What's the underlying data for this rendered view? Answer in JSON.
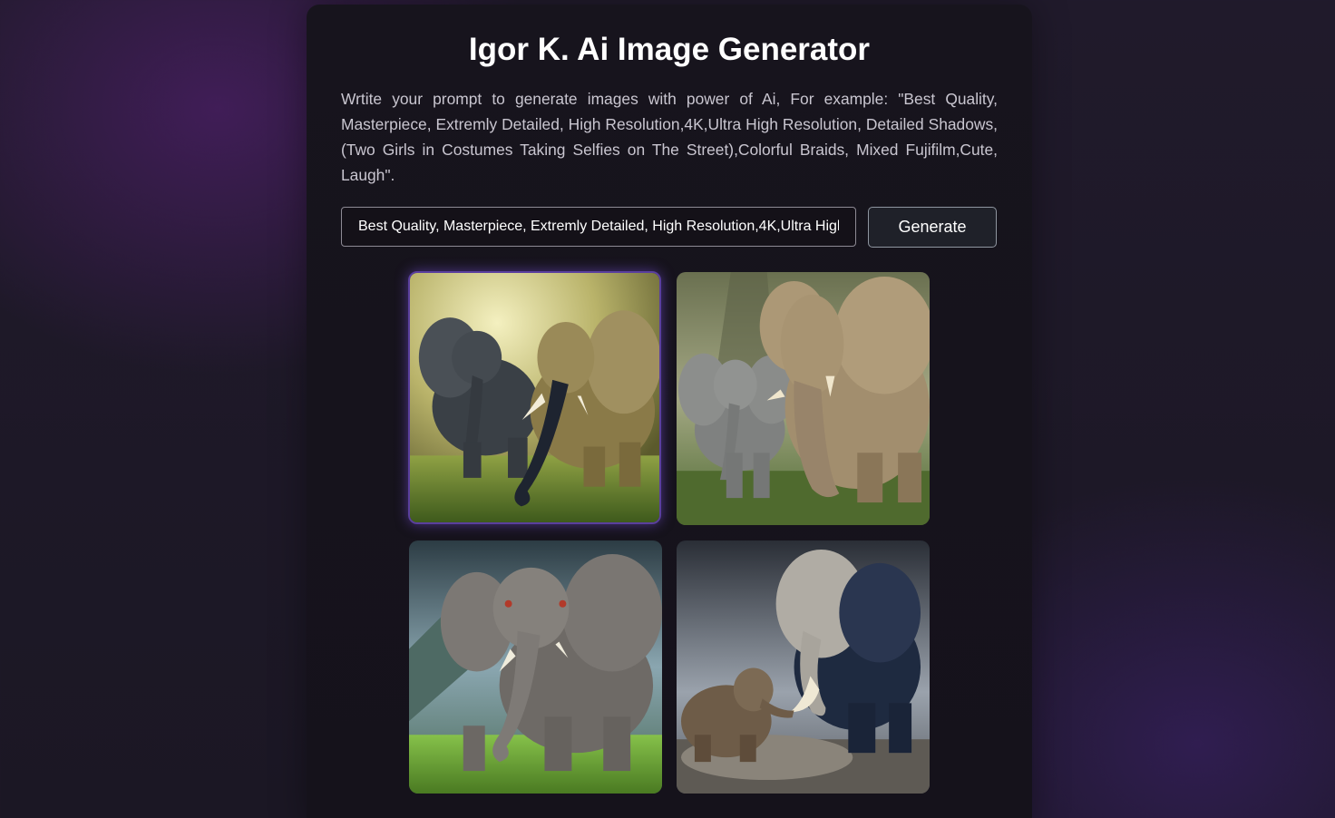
{
  "header": {
    "title": "Igor K. Ai Image Generator"
  },
  "intro": {
    "description": "Wrtite your prompt to generate images with power of Ai, For example: \"Best Quality, Masterpiece, Extremly Detailed, High Resolution,4K,Ultra High Resolution, Detailed Shadows,(Two Girls in Costumes Taking Selfies on The Street),Colorful Braids, Mixed Fujifilm,Cute, Laugh\"."
  },
  "prompt": {
    "value": "Best Quality, Masterpiece, Extremly Detailed, High Resolution,4K,Ultra High Resolution, Detailed Shadows,(Two Girls in Costumes Taking Selfies on The Street),Colorful Braids, Mixed Fujifilm,Cute, Laugh",
    "generate_label": "Generate"
  },
  "gallery": {
    "images": [
      {
        "subject": "two elephants on grass, warm golden light",
        "selected": true
      },
      {
        "subject": "adult and young elephant in misty forest",
        "selected": false
      },
      {
        "subject": "grey elephant on green field, cloudy mountains",
        "selected": false
      },
      {
        "subject": "elephant and calf on stone, stormy sky",
        "selected": false
      }
    ]
  },
  "colors": {
    "accent_selected": "#5a3f9e",
    "card_bg": "#17141d",
    "button_bg": "#1f2129"
  }
}
